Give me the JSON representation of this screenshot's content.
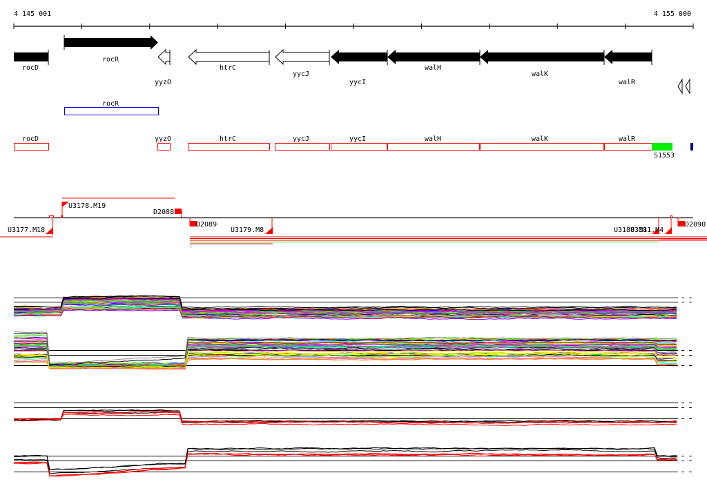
{
  "ruler": {
    "start_label": "4 145 001",
    "end_label": "4 155 000",
    "start": 4145001,
    "end": 4155000
  },
  "genes": [
    {
      "name": "rocD",
      "strand": "-",
      "filled": true,
      "start": 4145001,
      "end": 4145510
    },
    {
      "name": "rocR",
      "strand": "+",
      "filled": true,
      "start": 4145750,
      "end": 4147135
    },
    {
      "name": "yyzO",
      "strand": "-",
      "filled": false,
      "start": 4147125,
      "end": 4147310
    },
    {
      "name": "htrC",
      "strand": "-",
      "filled": false,
      "start": 4147570,
      "end": 4148770
    },
    {
      "name": "yycJ",
      "strand": "-",
      "filled": false,
      "start": 4148850,
      "end": 4149655
    },
    {
      "name": "yycI",
      "strand": "-",
      "filled": true,
      "start": 4149675,
      "end": 4150500
    },
    {
      "name": "walH",
      "strand": "-",
      "filled": true,
      "start": 4150510,
      "end": 4151870
    },
    {
      "name": "walK",
      "strand": "-",
      "filled": true,
      "start": 4151870,
      "end": 4153700
    },
    {
      "name": "walR",
      "strand": "-",
      "filled": true,
      "start": 4153700,
      "end": 4154400
    }
  ],
  "regulon": {
    "name": "rocR",
    "start": 4145750,
    "end": 4147135,
    "color": "#0000ff"
  },
  "transcripts": {
    "items": [
      {
        "name": "rocD",
        "start": 4145001,
        "end": 4145510
      },
      {
        "name": "yyzO",
        "start": 4147125,
        "end": 4147310
      },
      {
        "name": "htrC",
        "start": 4147570,
        "end": 4148770
      },
      {
        "name": "yycJ",
        "start": 4148850,
        "end": 4149655
      },
      {
        "name": "yycI",
        "start": 4149675,
        "end": 4150510
      },
      {
        "name": "walH",
        "start": 4150510,
        "end": 4151870
      },
      {
        "name": "walK",
        "start": 4151870,
        "end": 4153700
      },
      {
        "name": "walR",
        "start": 4153700,
        "end": 4154400
      }
    ],
    "srna": {
      "name": "S1553",
      "color": "#00ee00"
    },
    "color": "#ff0000"
  },
  "segments": {
    "upshifts": [
      "U3177.M18",
      "U3178.M19",
      "U3179.M8",
      "U3180.M11",
      "U3181.M4"
    ],
    "downshifts": [
      "D2088",
      "D2089",
      "D2090"
    ],
    "color": "#ff0000"
  },
  "colors": {
    "accent": "#ff0000",
    "green": "#00ee00",
    "navy": "#000080"
  }
}
